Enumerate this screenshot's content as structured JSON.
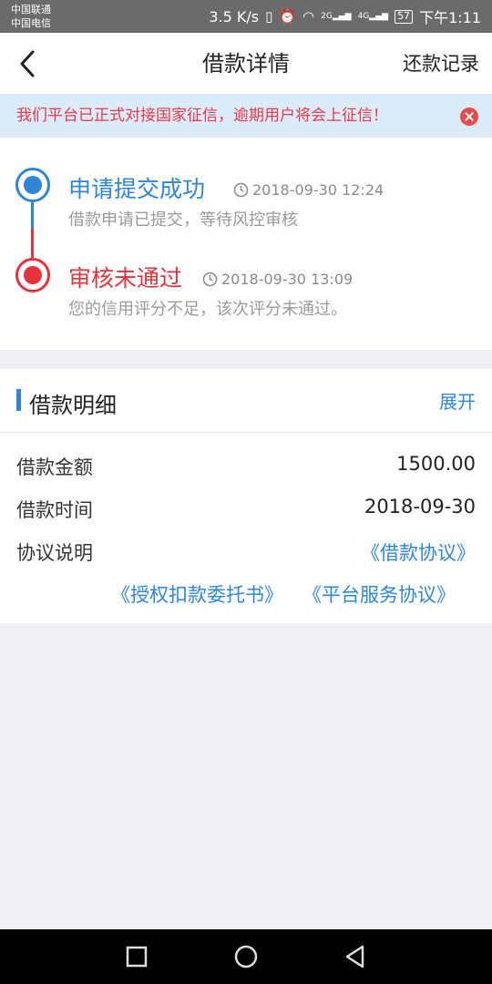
{
  "status_bar": {
    "carrier_1": "中国联通",
    "carrier_2": "中国电信",
    "network_speed": "3.5 K/s",
    "signal_1_label": "2G",
    "signal_2_label": "4G",
    "battery": "57",
    "time": "下午1:11"
  },
  "header": {
    "title": "借款详情",
    "action": "还款记录"
  },
  "notice": {
    "text": "我们平台已正式对接国家征信，逾期用户将会上征信！"
  },
  "timeline": [
    {
      "title": "申请提交成功",
      "time": "2018-09-30 12:24",
      "desc": "借款申请已提交，等待风控审核",
      "color": "#2f86d6"
    },
    {
      "title": "审核未通过",
      "time": "2018-09-30 13:09",
      "desc": "您的信用评分不足，该次评分未通过。",
      "color": "#e5333d"
    }
  ],
  "details": {
    "title": "借款明细",
    "expand": "展开",
    "rows": [
      {
        "label": "借款金额",
        "value": "1500.00"
      },
      {
        "label": "借款时间",
        "value": "2018-09-30"
      }
    ],
    "agreement_label": "协议说明",
    "agreements": [
      "《借款协议》",
      "《授权扣款委托书》",
      "《平台服务协议》"
    ]
  },
  "colors": {
    "accent": "#2f86d6",
    "danger": "#e5333d",
    "notice_bg": "#dcebf8"
  }
}
